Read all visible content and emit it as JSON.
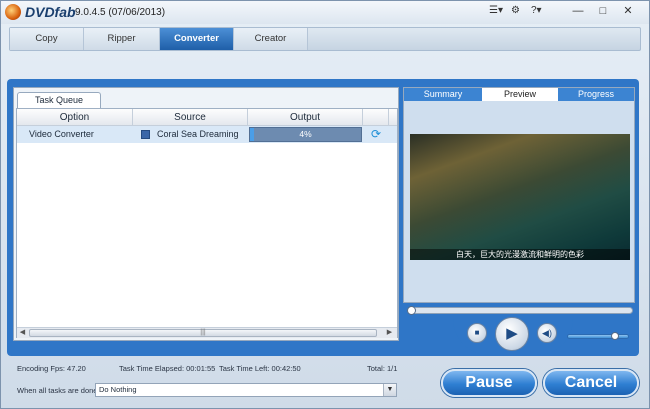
{
  "titlebar": {
    "brand": "DVDfab",
    "version": "9.0.4.5 (07/06/2013)",
    "settings_glyph": "☰▾",
    "gear_glyph": "⚙",
    "help_glyph": "?▾",
    "minimize_glyph": "—",
    "maximize_glyph": "□",
    "close_glyph": "✕"
  },
  "tabs": [
    {
      "label": "Copy"
    },
    {
      "label": "Ripper"
    },
    {
      "label": "Converter"
    },
    {
      "label": "Creator"
    }
  ],
  "task_queue": {
    "tab_label": "Task Queue",
    "columns": [
      "Option",
      "Source",
      "Output"
    ],
    "rows": [
      {
        "option": "Video Converter",
        "source": "Coral Sea Dreaming",
        "progress_text": "4%",
        "progress": 0.04
      }
    ],
    "scroll_thumb_glyph": "|||"
  },
  "preview_panel": {
    "tabs": [
      "Summary",
      "Preview",
      "Progress"
    ],
    "active_tab": "Preview",
    "subtitle": "白天，巨大的光漫激流和鲜明的色彩"
  },
  "status": {
    "encoding_fps": "Encoding Fps: 47.20",
    "elapsed": "Task Time Elapsed: 00:01:55",
    "left": "Task Time Left: 00:42:50",
    "total": "Total: 1/1"
  },
  "when_done": {
    "label": "When all tasks are done:",
    "value": "Do Nothing"
  },
  "buttons": {
    "pause": "Pause",
    "cancel": "Cancel"
  },
  "colors": {
    "accent": "#2f76c7",
    "active_tab": "#1f5fa8",
    "progress_fill": "#4a9ee8"
  },
  "player": {
    "volume": 0.8,
    "seek": 0.0
  }
}
